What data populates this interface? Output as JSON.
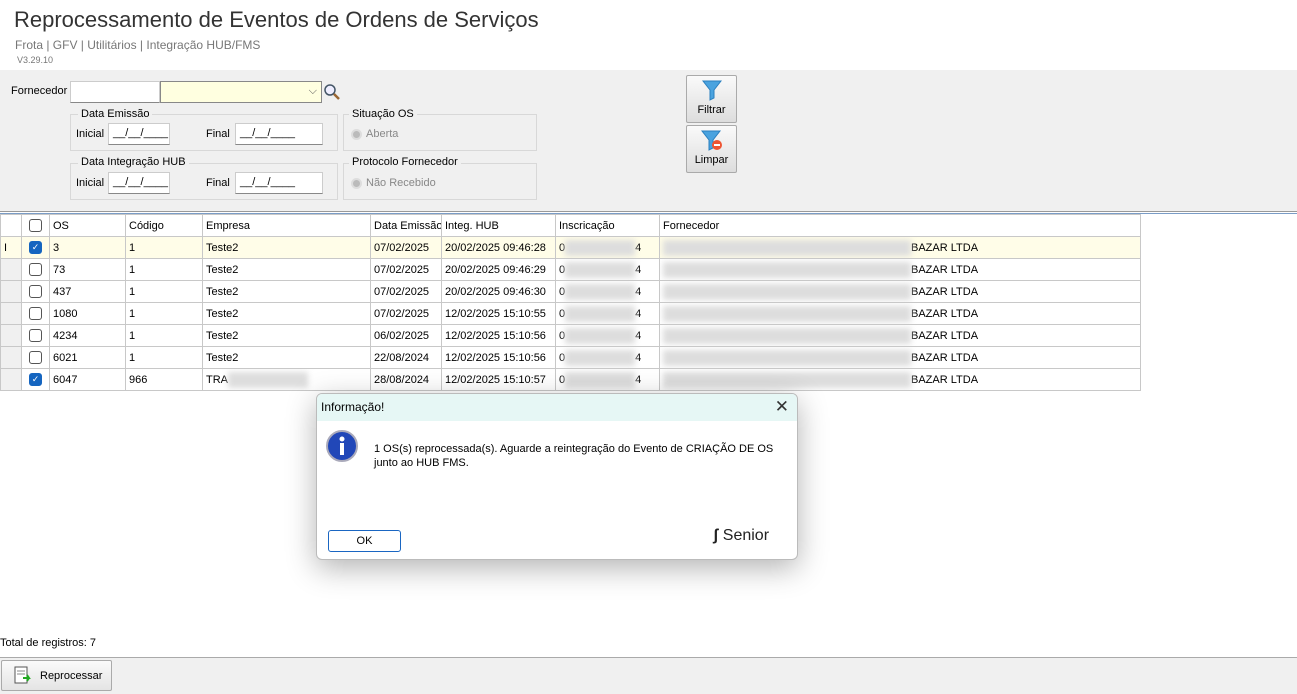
{
  "header": {
    "title": "Reprocessamento de Eventos de Ordens de Serviços",
    "breadcrumb": "Frota | GFV | Utilitários | Integração HUB/FMS",
    "version": "V3.29.10"
  },
  "filter": {
    "fornecedor_label": "Fornecedor",
    "fornecedor_code": "",
    "fornecedor_name": "",
    "data_emissao": {
      "legend": "Data Emissão",
      "inicial_label": "Inicial",
      "inicial": "__/__/____",
      "final_label": "Final",
      "final": "__/__/____"
    },
    "data_hub": {
      "legend": "Data Integração HUB",
      "inicial_label": "Inicial",
      "inicial": "__/__/____",
      "final_label": "Final",
      "final": "__/__/____"
    },
    "situacao": {
      "legend": "Situação OS",
      "option": "Aberta"
    },
    "protocolo": {
      "legend": "Protocolo Fornecedor",
      "option": "Não Recebido"
    },
    "filtrar": "Filtrar",
    "limpar": "Limpar"
  },
  "grid": {
    "columns": [
      "OS",
      "Código",
      "Empresa",
      "Data Emissão",
      "Integ. HUB",
      "Inscricação",
      "Fornecedor"
    ],
    "rows": [
      {
        "checked": true,
        "os": "3",
        "codigo": "1",
        "empresa": "Teste2",
        "emissao": "07/02/2025",
        "hub": "20/02/2025 09:46:28",
        "insc_a": "0",
        "insc_b": "4",
        "fornecedor": "BAZAR LTDA"
      },
      {
        "checked": false,
        "os": "73",
        "codigo": "1",
        "empresa": "Teste2",
        "emissao": "07/02/2025",
        "hub": "20/02/2025 09:46:29",
        "insc_a": "0",
        "insc_b": "4",
        "fornecedor": "BAZAR LTDA"
      },
      {
        "checked": false,
        "os": "437",
        "codigo": "1",
        "empresa": "Teste2",
        "emissao": "07/02/2025",
        "hub": "20/02/2025 09:46:30",
        "insc_a": "0",
        "insc_b": "4",
        "fornecedor": "BAZAR LTDA"
      },
      {
        "checked": false,
        "os": "1080",
        "codigo": "1",
        "empresa": "Teste2",
        "emissao": "07/02/2025",
        "hub": "12/02/2025 15:10:55",
        "insc_a": "0",
        "insc_b": "4",
        "fornecedor": "BAZAR LTDA"
      },
      {
        "checked": false,
        "os": "4234",
        "codigo": "1",
        "empresa": "Teste2",
        "emissao": "06/02/2025",
        "hub": "12/02/2025 15:10:56",
        "insc_a": "0",
        "insc_b": "4",
        "fornecedor": "BAZAR LTDA"
      },
      {
        "checked": false,
        "os": "6021",
        "codigo": "1",
        "empresa": "Teste2",
        "emissao": "22/08/2024",
        "hub": "12/02/2025 15:10:56",
        "insc_a": "0",
        "insc_b": "4",
        "fornecedor": "BAZAR LTDA"
      },
      {
        "checked": true,
        "os": "6047",
        "codigo": "966",
        "empresa": "TRA",
        "emissao": "28/08/2024",
        "hub": "12/02/2025 15:10:57",
        "insc_a": "0",
        "insc_b": "4",
        "fornecedor": "BAZAR LTDA"
      }
    ]
  },
  "footer": {
    "total": "Total de registros: 7",
    "reprocessar": "Reprocessar"
  },
  "dialog": {
    "title": "Informação!",
    "message": "1 OS(s) reprocessada(s). Aguarde a reintegração do Evento de CRIAÇÃO DE OS junto ao HUB FMS.",
    "ok": "OK",
    "logo": "Senior"
  }
}
